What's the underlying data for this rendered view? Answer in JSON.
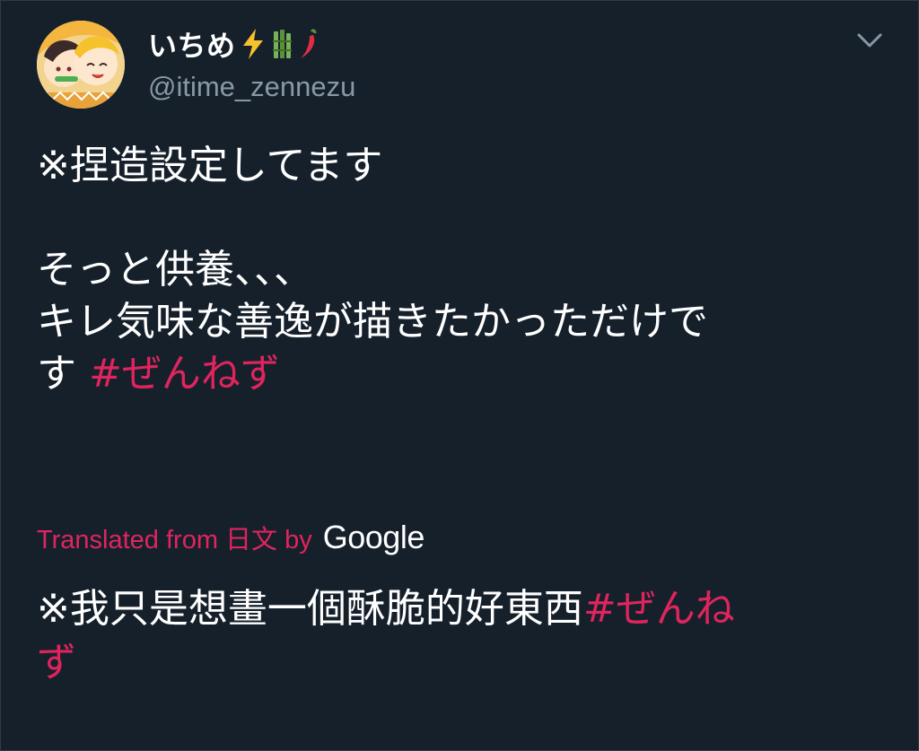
{
  "tweet": {
    "author": {
      "display_name": "いちめ",
      "handle": "@itime_zennezu",
      "emoji_icons": [
        "lightning-icon",
        "bamboo-icon",
        "chili-icon"
      ]
    },
    "text_lines": [
      "※捏造設定してます",
      "そっと供養、、、",
      "キレ気味な善逸が描きたかっただけで",
      "す"
    ],
    "hashtag": "#ぜんねず",
    "translation": {
      "label": "Translated from 日文 by",
      "provider": "Google",
      "text_line1": "※我只是想畫一個酥脆的好東西",
      "hashtag_line1": "#ぜんね",
      "hashtag_line2": "ず"
    }
  },
  "colors": {
    "background": "#15202b",
    "text": "#ffffff",
    "secondary": "#8899a6",
    "accent": "#e0245e"
  }
}
